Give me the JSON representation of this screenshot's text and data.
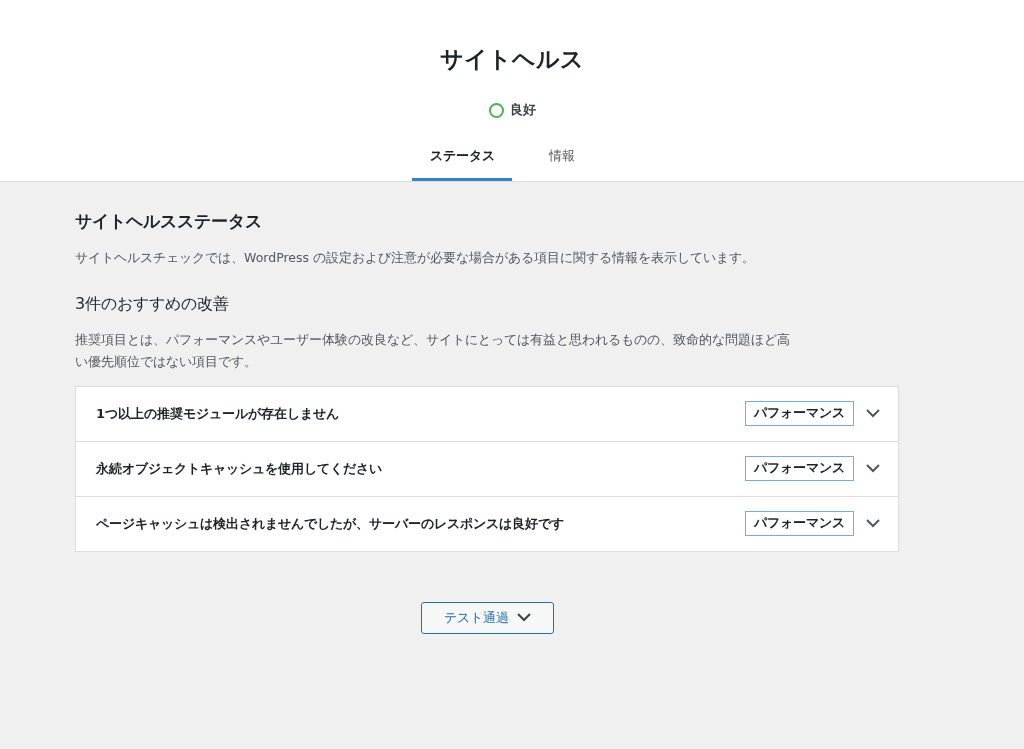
{
  "header": {
    "title": "サイトヘルス",
    "status": {
      "kind": "good",
      "label": "良好"
    }
  },
  "tabs": [
    {
      "label": "ステータス",
      "selected": true
    },
    {
      "label": "情報",
      "selected": false
    }
  ],
  "section": {
    "title": "サイトヘルスステータス",
    "description": "サイトヘルスチェックでは、WordPress の設定および注意が必要な場合がある項目に関する情報を表示しています。"
  },
  "recommended": {
    "title": "3件のおすすめの改善",
    "description": "推奨項目とは、パフォーマンスやユーザー体験の改良など、サイトにとっては有益と思われるものの、致命的な問題ほど高い優先順位ではない項目です。",
    "items": [
      {
        "title": "1つ以上の推奨モジュールが存在しません",
        "badge": "パフォーマンス",
        "expanded": false
      },
      {
        "title": "永続オブジェクトキャッシュを使用してください",
        "badge": "パフォーマンス",
        "expanded": false
      },
      {
        "title": "ページキャッシュは検出されませんでしたが、サーバーのレスポンスは良好です",
        "badge": "パフォーマンス",
        "expanded": false
      }
    ]
  },
  "passed_button": {
    "label": "テスト通過",
    "expanded": false
  }
}
